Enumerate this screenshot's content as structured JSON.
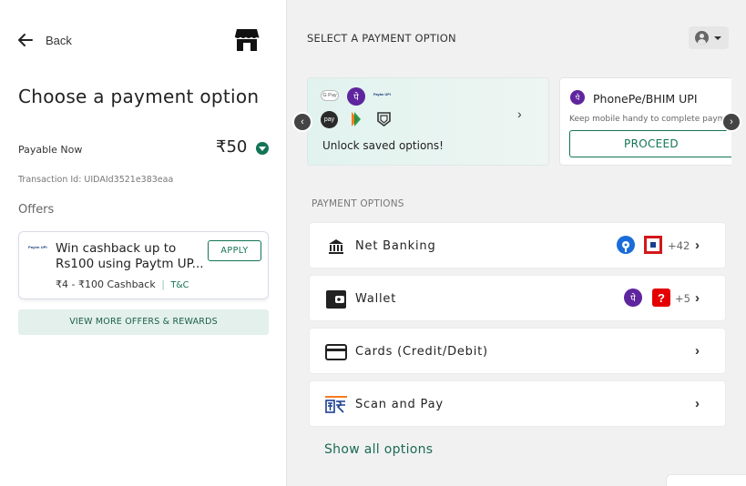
{
  "left": {
    "back_label": "Back",
    "title": "Choose a payment option",
    "payable_label": "Payable Now",
    "amount": "₹50",
    "transaction": "Transaction Id: UIDAId3521e383eaa",
    "offers_heading": "Offers",
    "offer": {
      "logo_text": "Paytm UPI",
      "text": "Win cashback up to Rs100 using Paytm UP...",
      "cashback": "₹4 - ₹100 Cashback",
      "separator": "|",
      "tnc": "T&C",
      "apply_label": "APPLY"
    },
    "view_more_label": "VIEW MORE OFFERS & REWARDS"
  },
  "right": {
    "header": "SELECT A PAYMENT OPTION",
    "saved": {
      "text": "Unlock saved options!",
      "icons": [
        "gpay-icon",
        "phonepe-icon",
        "paytm-icon",
        "amazon-pay-icon",
        "bhim-icon",
        "cred-icon"
      ],
      "gpay_text": "G Pay",
      "paytm_text": "Paytm UPI",
      "amazon_text": "pay"
    },
    "upi": {
      "name": "PhonePe/BHIM UPI",
      "hint": "Keep mobile handy to complete paym",
      "proceed_label": "PROCEED"
    },
    "section_label": "PAYMENT OPTIONS",
    "options": [
      {
        "label": "Net Banking",
        "more": "+42",
        "icon": "bank-icon"
      },
      {
        "label": "Wallet",
        "more": "+5",
        "icon": "wallet-icon"
      },
      {
        "label": "Cards (Credit/Debit)",
        "icon": "card-icon"
      },
      {
        "label": "Scan and Pay",
        "icon": "bharat-qr-icon"
      }
    ],
    "show_all_label": "Show all options"
  },
  "colors": {
    "accent": "#137456",
    "offer_bg": "#e3f0ec",
    "phonepe": "#5f259f",
    "sbi_blue": "#1a6dd8",
    "hdfc_red": "#d3171b",
    "airtel_red": "#e40000"
  }
}
